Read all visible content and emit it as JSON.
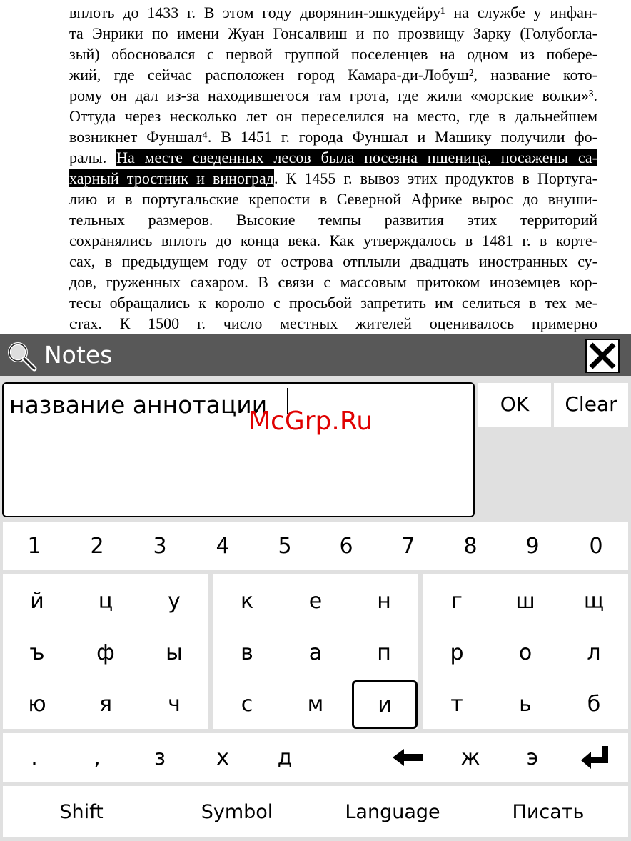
{
  "book": {
    "lines": [
      "вплоть до 1433 г. В этом году дворянин-эшкудейру¹ на службе у инфан-",
      "та Энрики по имени Жуан Гонсалвиш и по прозвищу Зарку (Голубогла-",
      "зый) обосновался с первой группой поселенцев на одном из побере-",
      "жий, где сейчас расположен город Камара-ди-Лобуш², название кото-",
      "рому он дал из-за находившегося там грота, где жили «морские волки»³.",
      "Оттуда через несколько лет он переселился на место, где в дальнейшем",
      "возникнет Фуншал⁴. В 1451 г. города Фуншал и Машику получили фо-"
    ],
    "line7_pre": "ралы. ",
    "line7_hl": "На месте сведенных лесов была посеяна пшеница, посажены са-",
    "line8_hl": "харный тростник и виноград",
    "line8_post": ". К 1455 г. вывоз этих продуктов в Португа-",
    "lines_after": [
      "лию и в португальские крепости в Северной Африке вырос до внуши-",
      "тельных размеров. Высокие темпы развития этих территорий",
      "сохранялись вплоть до конца века. Как утверждалось в 1481 г. в корте-",
      "сах, в предыдущем году от острова отплыли двадцать иностранных су-",
      "дов, груженных сахаром. В связи с массовым притоком иноземцев кор-",
      "тесы обращались к королю с просьбой запретить им селиться в тех ме-",
      "стах. К 1500 г. число местных жителей оценивалось примерно"
    ]
  },
  "dialog": {
    "title": "Notes",
    "input_value": "название аннотации",
    "ok_label": "OK",
    "clear_label": "Clear"
  },
  "keyboard": {
    "digits": [
      "1",
      "2",
      "3",
      "4",
      "5",
      "6",
      "7",
      "8",
      "9",
      "0"
    ],
    "row1": [
      "й",
      "ц",
      "у",
      "к",
      "е",
      "н",
      "г",
      "ш",
      "щ"
    ],
    "row2": [
      "ъ",
      "ф",
      "ы",
      "в",
      "а",
      "п",
      "р",
      "о",
      "л"
    ],
    "row3": [
      "ю",
      "я",
      "ч",
      "с",
      "м",
      "и",
      "т",
      "ь",
      "б"
    ],
    "row4": [
      ".",
      ",",
      "з",
      "х",
      "д",
      "ж",
      "э"
    ],
    "shift": "Shift",
    "symbol": "Symbol",
    "language": "Language",
    "write": "Писать",
    "selected_key": "и"
  },
  "watermark": "McGrp.Ru",
  "colors": {
    "title_bar": "#585858",
    "panel": "#e0e0e0",
    "watermark": "#e00000"
  }
}
